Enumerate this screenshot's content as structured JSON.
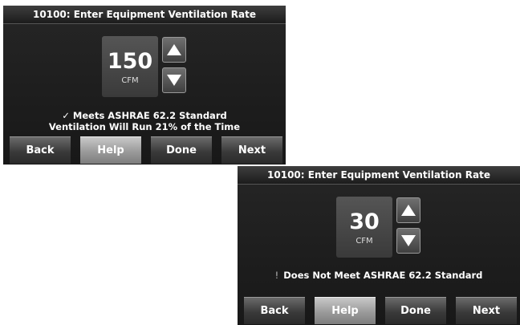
{
  "screens": [
    {
      "title": "10100: Enter Equipment Ventilation Rate",
      "value": "150",
      "unit": "CFM",
      "status_mark": "✓",
      "status_line1": "Meets ASHRAE 62.2 Standard",
      "status_line2": "Ventilation Will Run 21% of the Time",
      "buttons": {
        "back": "Back",
        "help": "Help",
        "done": "Done",
        "next": "Next"
      }
    },
    {
      "title": "10100: Enter Equipment Ventilation Rate",
      "value": "30",
      "unit": "CFM",
      "status_mark": "!",
      "status_line1": "Does Not Meet ASHRAE 62.2 Standard",
      "buttons": {
        "back": "Back",
        "help": "Help",
        "done": "Done",
        "next": "Next"
      }
    }
  ],
  "icons": {
    "increase": "up-arrow-icon",
    "decrease": "down-arrow-icon",
    "meets": "check-icon",
    "warning": "exclamation-icon"
  },
  "colors": {
    "screen_bg": "#1d1d1d",
    "button": "#3a3a3a",
    "help_button": "#9a9a9a",
    "text": "#ffffff"
  }
}
